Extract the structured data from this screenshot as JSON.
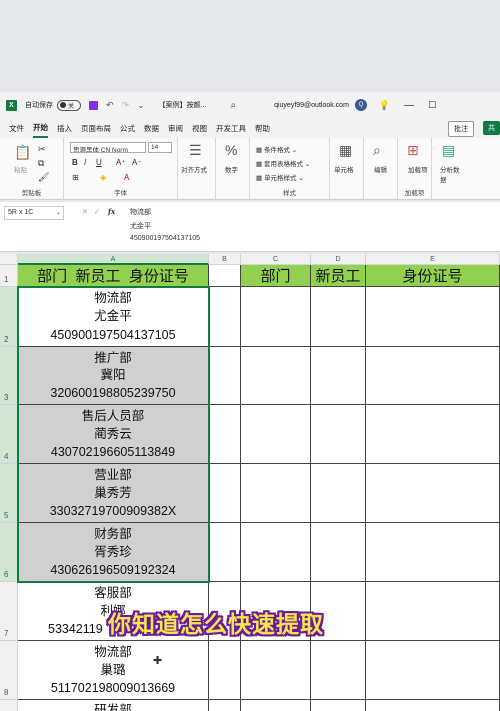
{
  "titlebar": {
    "app_icon": "X",
    "autosave_label": "自动保存",
    "autosave_state": "关",
    "doc_title": "【案例】按颜...",
    "search_icon": "search-icon",
    "account_email": "qiuyeyf99@outlook.com",
    "avatar_letter": "Q"
  },
  "menu": {
    "tabs": [
      "文件",
      "开始",
      "插入",
      "页面布局",
      "公式",
      "数据",
      "审阅",
      "视图",
      "开发工具",
      "帮助"
    ],
    "active_tab": "开始",
    "comment_label": "批注",
    "share_label": "共"
  },
  "ribbon": {
    "paste_label": "粘贴",
    "clipboard_label": "剪贴板",
    "font_name": "思源黑体 CN Norm",
    "font_size": "14",
    "font_label": "字体",
    "align_label": "对齐方式",
    "number_label": "数字",
    "cond_format": "条件格式",
    "table_format": "套用表格格式",
    "cell_style": "单元格样式",
    "styles_label": "样式",
    "cells_label": "单元格",
    "edit_label": "编辑",
    "addin_label": "加载项",
    "addin_group": "加载项",
    "analyze_label": "分析数据"
  },
  "formula_bar": {
    "name_box": "5R x 1C",
    "fx": "fx",
    "lines": [
      "物流部",
      "尤金平",
      "450900197504137105"
    ]
  },
  "sheet": {
    "columns": [
      "A",
      "B",
      "C",
      "D",
      "E"
    ],
    "rows": [
      "1",
      "2",
      "3",
      "4",
      "5",
      "6",
      "7",
      "8"
    ],
    "left_header": "部门  新员工  身份证号",
    "right_headers": [
      "部门",
      "新员工",
      "身份证号"
    ],
    "records": [
      {
        "dept": "物流部",
        "name": "尤金平",
        "id": "450900197504137105",
        "shaded": false
      },
      {
        "dept": "推广部",
        "name": "冀阳",
        "id": "320600198805239750",
        "shaded": true
      },
      {
        "dept": "售后人员部",
        "name": "蔺秀云",
        "id": "430702196605113849",
        "shaded": true
      },
      {
        "dept": "营业部",
        "name": "巢秀芳",
        "id": "33032719700909382X",
        "shaded": true
      },
      {
        "dept": "财务部",
        "name": "胥秀珍",
        "id": "430626196509192324",
        "shaded": true
      },
      {
        "dept": "客服部",
        "name": "利娜",
        "id": "53342119",
        "shaded": false
      },
      {
        "dept": "物流部",
        "name": "巢璐",
        "id": "511702198009013669",
        "shaded": false
      },
      {
        "dept": "研发部",
        "name": "",
        "id": "",
        "shaded": false
      }
    ]
  },
  "caption": "你知道怎么快速提取",
  "colors": {
    "excel_green": "#107c41",
    "header_green": "#92d050",
    "shaded_gray": "#d0d0d0",
    "caption_yellow": "#f4e64a",
    "caption_outline": "#6a1b9a"
  }
}
